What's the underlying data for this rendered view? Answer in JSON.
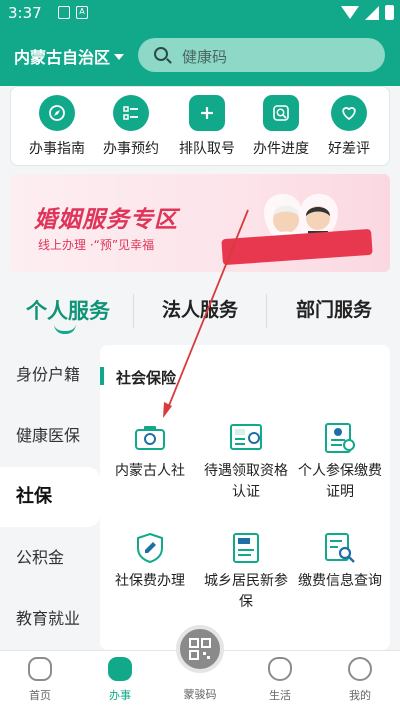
{
  "status": {
    "time": "3:37"
  },
  "header": {
    "region": "内蒙古自治区",
    "search_placeholder": "健康码"
  },
  "quick_actions": [
    {
      "label": "办事指南",
      "icon": "compass-icon"
    },
    {
      "label": "办事预约",
      "icon": "checklist-icon"
    },
    {
      "label": "排队取号",
      "icon": "plus-icon"
    },
    {
      "label": "办件进度",
      "icon": "progress-search-icon"
    },
    {
      "label": "好差评",
      "icon": "heart-icon"
    }
  ],
  "banner": {
    "title": "婚姻服务专区",
    "subtitle": "线上办理 ·“预”见幸福"
  },
  "tabs": [
    {
      "label": "个人服务",
      "active": true
    },
    {
      "label": "法人服务",
      "active": false
    },
    {
      "label": "部门服务",
      "active": false
    }
  ],
  "sidebar": [
    {
      "label": "身份户籍"
    },
    {
      "label": "健康医保"
    },
    {
      "label": "社保",
      "active": true
    },
    {
      "label": "公积金"
    },
    {
      "label": "教育就业"
    }
  ],
  "section": {
    "title": "社会保险"
  },
  "services": [
    {
      "label": "内蒙古人社",
      "icon": "camera-icon"
    },
    {
      "label": "待遇领取资格认证",
      "icon": "certificate-icon"
    },
    {
      "label": "个人参保缴费证明",
      "icon": "document-proof-icon"
    },
    {
      "label": "社保费办理",
      "icon": "shield-edit-icon"
    },
    {
      "label": "城乡居民新参保",
      "icon": "rural-insurance-icon"
    },
    {
      "label": "缴费信息查询",
      "icon": "document-search-icon"
    }
  ],
  "bottom_nav": [
    {
      "label": "首页"
    },
    {
      "label": "办事",
      "active": true
    },
    {
      "label": "蒙骏码"
    },
    {
      "label": "生活"
    },
    {
      "label": "我的"
    }
  ],
  "colors": {
    "primary": "#12a98b",
    "banner_red": "#e0355a"
  }
}
